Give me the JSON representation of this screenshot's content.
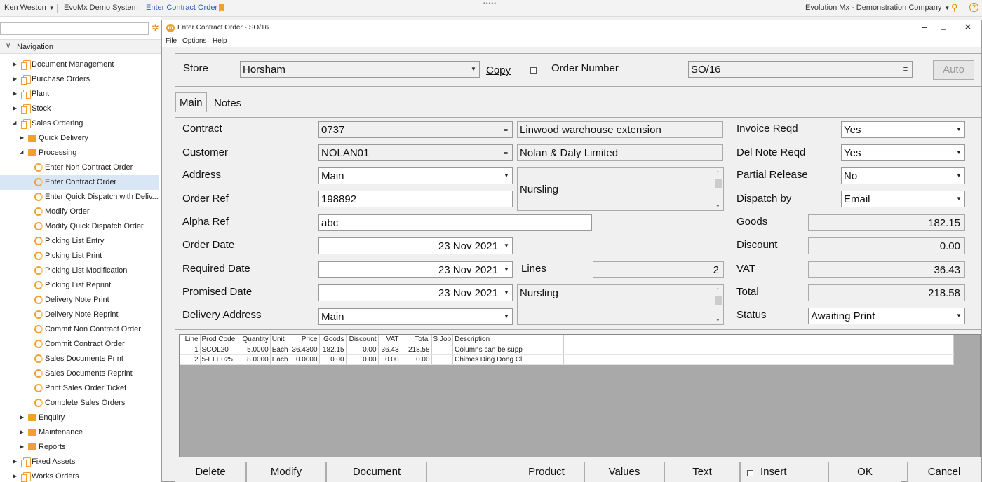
{
  "topbar": {
    "user": "Ken Weston",
    "system": "EvoMx Demo System",
    "current_page": "Enter Contract Order",
    "company": "Evolution Mx - Demonstration Company"
  },
  "sidebar": {
    "header": "Navigation",
    "items": [
      {
        "label": "Document Management",
        "level": 0,
        "icon": "doc-icon",
        "expand": "right"
      },
      {
        "label": "Purchase Orders",
        "level": 0,
        "icon": "doc-icon",
        "expand": "right"
      },
      {
        "label": "Plant",
        "level": 0,
        "icon": "doc-icon",
        "expand": "right"
      },
      {
        "label": "Stock",
        "level": 0,
        "icon": "doc-icon",
        "expand": "right"
      },
      {
        "label": "Sales Ordering",
        "level": 0,
        "icon": "doc-icon",
        "expand": "down"
      },
      {
        "label": "Quick Delivery",
        "level": 1,
        "icon": "folder-icon",
        "expand": "right"
      },
      {
        "label": "Processing",
        "level": 1,
        "icon": "folder-icon",
        "expand": "down"
      },
      {
        "label": "Enter Non Contract Order",
        "level": 2,
        "icon": "process-icon"
      },
      {
        "label": "Enter Contract Order",
        "level": 2,
        "icon": "process-icon",
        "selected": true
      },
      {
        "label": "Enter Quick Dispatch with Deliv...",
        "level": 2,
        "icon": "process-icon"
      },
      {
        "label": "Modify Order",
        "level": 2,
        "icon": "process-icon"
      },
      {
        "label": "Modify Quick Dispatch Order",
        "level": 2,
        "icon": "process-icon"
      },
      {
        "label": "Picking List Entry",
        "level": 2,
        "icon": "process-icon"
      },
      {
        "label": "Picking List Print",
        "level": 2,
        "icon": "process-icon"
      },
      {
        "label": "Picking List Modification",
        "level": 2,
        "icon": "process-icon"
      },
      {
        "label": "Picking List Reprint",
        "level": 2,
        "icon": "process-icon"
      },
      {
        "label": "Delivery Note Print",
        "level": 2,
        "icon": "process-icon"
      },
      {
        "label": "Delivery Note Reprint",
        "level": 2,
        "icon": "process-icon"
      },
      {
        "label": "Commit Non Contract Order",
        "level": 2,
        "icon": "process-icon"
      },
      {
        "label": "Commit Contract Order",
        "level": 2,
        "icon": "process-icon"
      },
      {
        "label": "Sales Documents Print",
        "level": 2,
        "icon": "process-icon"
      },
      {
        "label": "Sales Documents Reprint",
        "level": 2,
        "icon": "process-icon"
      },
      {
        "label": "Print Sales Order Ticket",
        "level": 2,
        "icon": "process-icon"
      },
      {
        "label": "Complete Sales Orders",
        "level": 2,
        "icon": "process-icon"
      },
      {
        "label": "Enquiry",
        "level": 1,
        "icon": "folder-icon",
        "expand": "right"
      },
      {
        "label": "Maintenance",
        "level": 1,
        "icon": "folder-icon",
        "expand": "right"
      },
      {
        "label": "Reports",
        "level": 1,
        "icon": "folder-icon",
        "expand": "right"
      },
      {
        "label": "Fixed Assets",
        "level": 0,
        "icon": "doc-icon",
        "expand": "right"
      },
      {
        "label": "Works Orders",
        "level": 0,
        "icon": "doc-icon",
        "expand": "right"
      }
    ]
  },
  "window": {
    "title": "Enter Contract Order - SO/16",
    "menu": [
      "File",
      "Options",
      "Help"
    ]
  },
  "header": {
    "store_label": "Store",
    "store_value": "Horsham",
    "copy_label": "Copy",
    "order_number_label": "Order Number",
    "order_number_value": "SO/16",
    "auto_label": "Auto"
  },
  "tabs": [
    "Main",
    "Notes"
  ],
  "form": {
    "contract_label": "Contract",
    "contract_value": "0737",
    "contract_desc": "Linwood warehouse extension",
    "customer_label": "Customer",
    "customer_value": "NOLAN01",
    "customer_desc": "Nolan & Daly Limited",
    "address_label": "Address",
    "address_value": "Main",
    "address_text": "Nursling",
    "order_ref_label": "Order Ref",
    "order_ref_value": "198892",
    "alpha_ref_label": "Alpha Ref",
    "alpha_ref_value": "abc",
    "order_date_label": "Order Date",
    "order_date_value": "23 Nov 2021",
    "required_date_label": "Required Date",
    "required_date_value": "23 Nov 2021",
    "lines_label": "Lines",
    "lines_value": "2",
    "promised_date_label": "Promised Date",
    "promised_date_value": "23 Nov 2021",
    "delivery_text": "Nursling",
    "delivery_address_label": "Delivery Address",
    "delivery_address_value": "Main",
    "invoice_reqd_label": "Invoice Reqd",
    "invoice_reqd_value": "Yes",
    "del_note_reqd_label": "Del Note Reqd",
    "del_note_reqd_value": "Yes",
    "partial_release_label": "Partial Release",
    "partial_release_value": "No",
    "dispatch_by_label": "Dispatch by",
    "dispatch_by_value": "Email",
    "goods_label": "Goods",
    "goods_value": "182.15",
    "discount_label": "Discount",
    "discount_value": "0.00",
    "vat_label": "VAT",
    "vat_value": "36.43",
    "total_label": "Total",
    "total_value": "218.58",
    "status_label": "Status",
    "status_value": "Awaiting Print"
  },
  "grid": {
    "columns": [
      "Line",
      "Prod Code",
      "Quantity",
      "Unit",
      "Price",
      "Goods",
      "Discount",
      "VAT",
      "Total",
      "S Job",
      "Description"
    ],
    "rows": [
      [
        "1",
        "SCOL20",
        "5.0000",
        "Each",
        "36.4300",
        "182.15",
        "0.00",
        "36.43",
        "218.58",
        "",
        "Columns can be supp"
      ],
      [
        "2",
        "5-ELE025",
        "8.0000",
        "Each",
        "0.0000",
        "0.00",
        "0.00",
        "0.00",
        "0.00",
        "",
        "Chimes Ding Dong Cl"
      ]
    ]
  },
  "buttons": {
    "delete": "Delete",
    "modify": "Modify",
    "document": "Document",
    "product": "Product",
    "values": "Values",
    "text": "Text",
    "insert": "Insert",
    "ok": "OK",
    "cancel": "Cancel"
  }
}
